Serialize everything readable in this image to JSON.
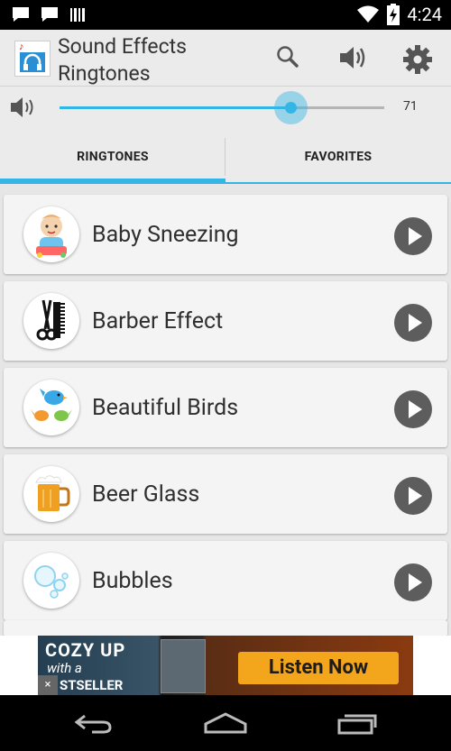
{
  "status_bar": {
    "time": "4:24"
  },
  "app_bar": {
    "title": "Sound Effects\nRingtones"
  },
  "volume": {
    "value": "71",
    "level": 0.71
  },
  "tabs": [
    {
      "label": "RINGTONES",
      "selected": true
    },
    {
      "label": "FAVORITES",
      "selected": false
    }
  ],
  "ringtones": [
    {
      "label": "Baby Sneezing",
      "icon": "baby-icon"
    },
    {
      "label": "Barber Effect",
      "icon": "scissors-comb-icon"
    },
    {
      "label": "Beautiful Birds",
      "icon": "birds-icon"
    },
    {
      "label": "Beer Glass",
      "icon": "beer-mug-icon"
    },
    {
      "label": "Bubbles",
      "icon": "bubbles-icon"
    }
  ],
  "ad": {
    "line1": "COZY UP",
    "line2": "with a",
    "line3": "STSELLER",
    "cta": "Listen Now",
    "close": "×"
  },
  "colors": {
    "accent": "#33b5e5",
    "play_button": "#5d5d5d",
    "ad_cta": "#f3a51c"
  }
}
